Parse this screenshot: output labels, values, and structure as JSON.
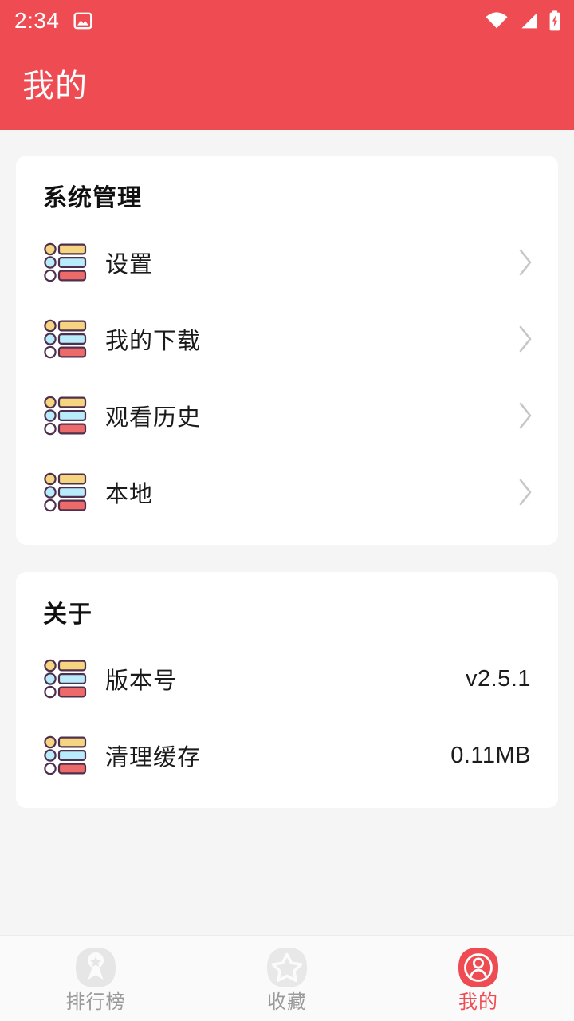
{
  "theme": {
    "accent": "#ee4c52",
    "page_bg": "#f5f5f6",
    "card_bg": "#ffffff",
    "nav_bg": "#fafafb",
    "text": "#1a1a1a",
    "muted": "#9a9a9a",
    "icon_yellow": "#f5d580",
    "icon_blue": "#b9ecfb",
    "icon_red": "#ed6a6a",
    "icon_outline": "#4e2f4e"
  },
  "status_bar": {
    "time": "2:34",
    "icons": [
      "image-icon",
      "wifi-icon",
      "cellular-signal-icon",
      "battery-charging-icon"
    ]
  },
  "app_bar": {
    "title": "我的"
  },
  "sections": [
    {
      "title": "系统管理",
      "rows": [
        {
          "label": "设置",
          "value": "",
          "accessory": "chevron-right-icon",
          "icon": "list-icon"
        },
        {
          "label": "我的下载",
          "value": "",
          "accessory": "chevron-right-icon",
          "icon": "list-icon"
        },
        {
          "label": "观看历史",
          "value": "",
          "accessory": "chevron-right-icon",
          "icon": "list-icon"
        },
        {
          "label": "本地",
          "value": "",
          "accessory": "chevron-right-icon",
          "icon": "list-icon"
        }
      ]
    },
    {
      "title": "关于",
      "rows": [
        {
          "label": "版本号",
          "value": "v2.5.1",
          "accessory": "",
          "icon": "list-icon"
        },
        {
          "label": "清理缓存",
          "value": "0.11MB",
          "accessory": "",
          "icon": "list-icon"
        }
      ]
    }
  ],
  "bottom_nav": {
    "items": [
      {
        "label": "排行榜",
        "icon": "medal-award-icon",
        "active": false
      },
      {
        "label": "收藏",
        "icon": "star-outline-icon",
        "active": false
      },
      {
        "label": "我的",
        "icon": "user-avatar-icon",
        "active": true
      }
    ]
  }
}
